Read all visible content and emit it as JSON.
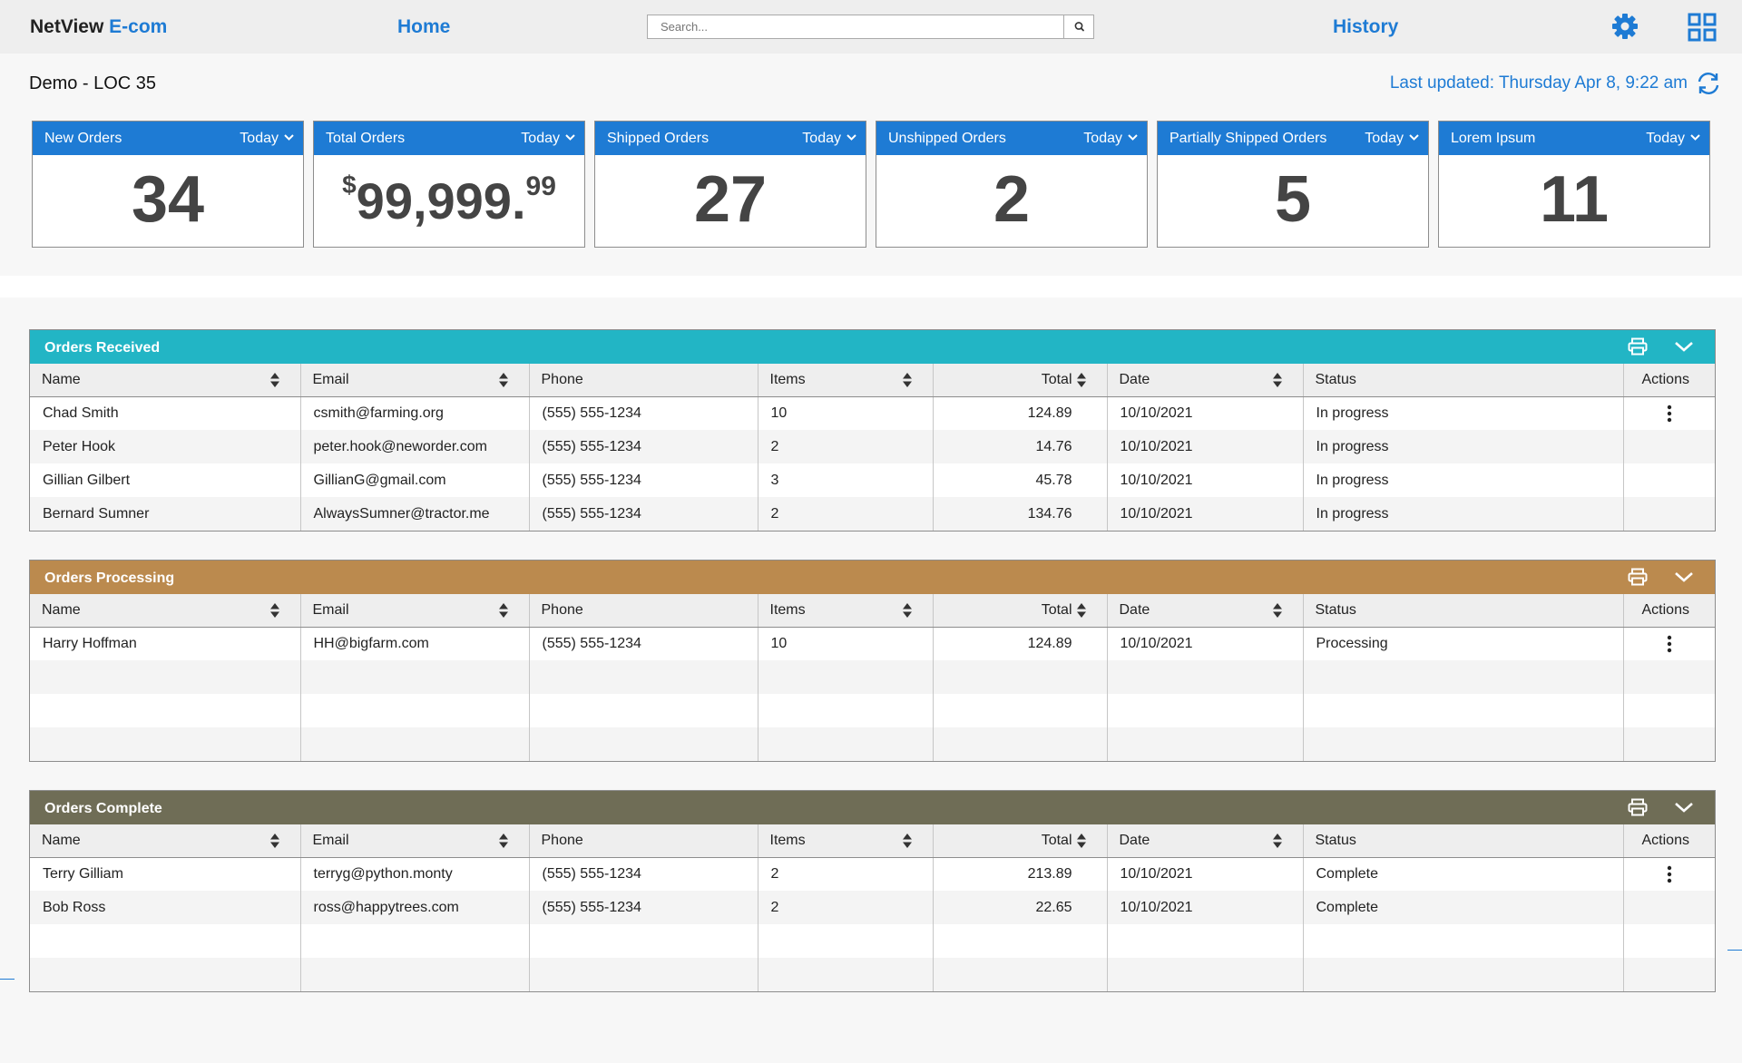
{
  "nav": {
    "brand_main": "NetView",
    "brand_accent": "E-com",
    "home": "Home",
    "search_placeholder": "Search...",
    "history": "History"
  },
  "header": {
    "location": "Demo - LOC 35",
    "last_updated": "Last updated: Thursday Apr 8, 9:22 am"
  },
  "kpis": [
    {
      "title": "New Orders",
      "range": "Today",
      "value": "34"
    },
    {
      "title": "Total Orders",
      "range": "Today",
      "currency": "$",
      "value_main": "99,999.",
      "value_cents": "99"
    },
    {
      "title": "Shipped Orders",
      "range": "Today",
      "value": "27"
    },
    {
      "title": "Unshipped Orders",
      "range": "Today",
      "value": "2"
    },
    {
      "title": "Partially Shipped Orders",
      "range": "Today",
      "value": "5"
    },
    {
      "title": "Lorem Ipsum",
      "range": "Today",
      "value": "11"
    }
  ],
  "columns": {
    "name": "Name",
    "email": "Email",
    "phone": "Phone",
    "items": "Items",
    "total": "Total",
    "date": "Date",
    "status": "Status",
    "actions": "Actions"
  },
  "colors": {
    "accent": "#1e7bd4",
    "received": "#22b5c5",
    "processing": "#bb8a4e",
    "complete": "#6f6d56"
  },
  "panels": [
    {
      "title": "Orders Received",
      "rows": [
        {
          "name": "Chad Smith",
          "email": "csmith@farming.org",
          "phone": "(555) 555-1234",
          "items": "10",
          "total": "124.89",
          "date": "10/10/2021",
          "status": "In progress"
        },
        {
          "name": "Peter Hook",
          "email": "peter.hook@neworder.com",
          "phone": "(555) 555-1234",
          "items": "2",
          "total": "14.76",
          "date": "10/10/2021",
          "status": "In progress"
        },
        {
          "name": "Gillian Gilbert",
          "email": "GillianG@gmail.com",
          "phone": "(555) 555-1234",
          "items": "3",
          "total": "45.78",
          "date": "10/10/2021",
          "status": "In progress"
        },
        {
          "name": "Bernard Sumner",
          "email": "AlwaysSumner@tractor.me",
          "phone": "(555) 555-1234",
          "items": "2",
          "total": "134.76",
          "date": "10/10/2021",
          "status": "In progress"
        }
      ]
    },
    {
      "title": "Orders Processing",
      "rows": [
        {
          "name": "Harry Hoffman",
          "email": "HH@bigfarm.com",
          "phone": "(555) 555-1234",
          "items": "10",
          "total": "124.89",
          "date": "10/10/2021",
          "status": "Processing"
        }
      ]
    },
    {
      "title": "Orders Complete",
      "rows": [
        {
          "name": "Terry Gilliam",
          "email": "terryg@python.monty",
          "phone": "(555) 555-1234",
          "items": "2",
          "total": "213.89",
          "date": "10/10/2021",
          "status": "Complete"
        },
        {
          "name": "Bob Ross",
          "email": "ross@happytrees.com",
          "phone": "(555) 555-1234",
          "items": "2",
          "total": "22.65",
          "date": "10/10/2021",
          "status": "Complete"
        }
      ]
    }
  ]
}
